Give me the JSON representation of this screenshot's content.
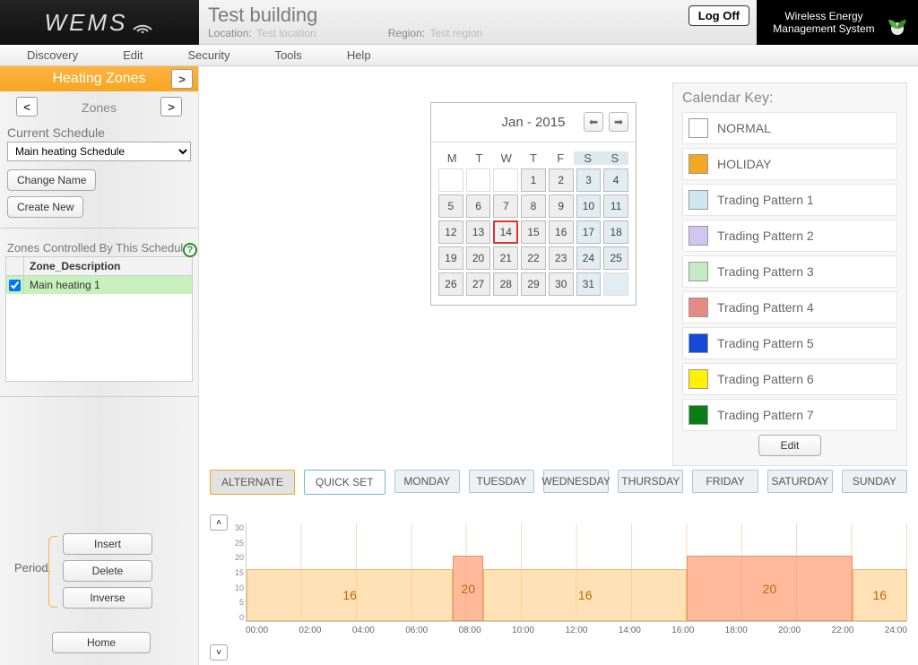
{
  "brand": {
    "logo_text": "WEMS",
    "right_line1": "Wireless Energy",
    "right_line2": "Management System"
  },
  "header": {
    "building": "Test building",
    "location_label": "Location:",
    "location": "Test location",
    "region_label": "Region:",
    "region": "Test region",
    "logoff": "Log Off"
  },
  "menu": [
    "Discovery",
    "Edit",
    "Security",
    "Tools",
    "Help"
  ],
  "sidebar": {
    "section": "Heating Zones",
    "zones_label": "Zones",
    "current_schedule": "Current Schedule",
    "schedule_options": [
      "Main heating Schedule"
    ],
    "change_name": "Change Name",
    "create_new": "Create New",
    "controlled_hdr": "Zones Controlled By This Schedule",
    "table_header": "Zone_Description",
    "table_row": "Main heating 1",
    "period_label": "Period",
    "period_buttons": [
      "Insert",
      "Delete",
      "Inverse"
    ],
    "home": "Home"
  },
  "calendar": {
    "title": "Jan - 2015",
    "dow": [
      "M",
      "T",
      "W",
      "T",
      "F",
      "S",
      "S"
    ],
    "leading_blanks": 3,
    "days": 31,
    "today": 14
  },
  "key": {
    "title": "Calendar Key:",
    "items": [
      {
        "label": "NORMAL",
        "color": "#ffffff"
      },
      {
        "label": "HOLIDAY",
        "color": "#f5a623"
      },
      {
        "label": "Trading Pattern 1",
        "color": "#cfe6ef"
      },
      {
        "label": "Trading Pattern 2",
        "color": "#cfc6f2"
      },
      {
        "label": "Trading Pattern 3",
        "color": "#c6e8c3"
      },
      {
        "label": "Trading Pattern 4",
        "color": "#e48b84"
      },
      {
        "label": "Trading Pattern 5",
        "color": "#1549d6"
      },
      {
        "label": "Trading Pattern 6",
        "color": "#fff200"
      },
      {
        "label": "Trading Pattern 7",
        "color": "#0a7d17"
      }
    ],
    "edit": "Edit"
  },
  "tabs": {
    "alternate": "ALTERNATE",
    "quickset": "QUICK SET",
    "days": [
      "MONDAY",
      "TUESDAY",
      "WEDNESDAY",
      "THURSDAY",
      "FRIDAY",
      "SATURDAY",
      "SUNDAY"
    ]
  },
  "chart_data": {
    "type": "bar",
    "xlabel": "",
    "ylabel": "",
    "ylim": [
      0,
      30
    ],
    "y_ticks": [
      30,
      25,
      20,
      15,
      10,
      5,
      0
    ],
    "x_ticks": [
      "00:00",
      "02:00",
      "04:00",
      "06:00",
      "08:00",
      "10:00",
      "12:00",
      "14:00",
      "16:00",
      "18:00",
      "20:00",
      "22:00",
      "24:00"
    ],
    "segments": [
      {
        "start_h": 0.0,
        "end_h": 7.5,
        "value": 16,
        "level": "low"
      },
      {
        "start_h": 7.5,
        "end_h": 8.6,
        "value": 20,
        "level": "high"
      },
      {
        "start_h": 8.6,
        "end_h": 16.0,
        "value": 16,
        "level": "low"
      },
      {
        "start_h": 16.0,
        "end_h": 22.0,
        "value": 20,
        "level": "high"
      },
      {
        "start_h": 22.0,
        "end_h": 24.0,
        "value": 16,
        "level": "low"
      }
    ]
  }
}
